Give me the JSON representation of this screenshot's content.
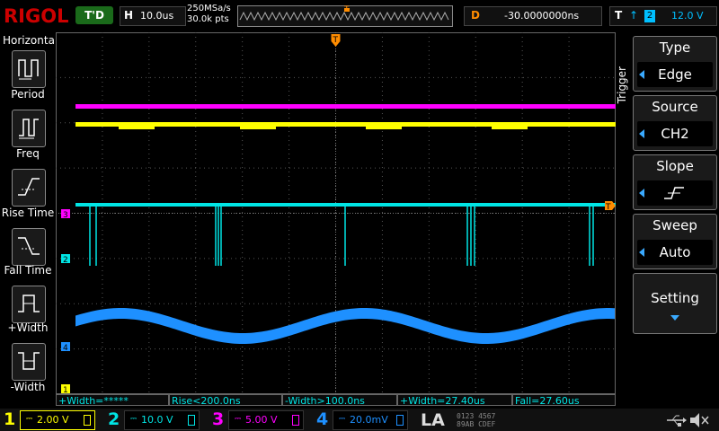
{
  "brand": {
    "logo": "RIGOL"
  },
  "topbar": {
    "run_state": "T'D",
    "horizontal": {
      "key": "H",
      "value": "10.0us"
    },
    "sample_rate": "250MSa/s",
    "mem_depth": "30.0k pts",
    "trigger_marker": "T",
    "delay": {
      "key": "D",
      "value": "-30.0000000ns"
    },
    "trigger": {
      "key": "T",
      "edge_symbol": "↑",
      "channel": "2",
      "level": "12.0 V"
    }
  },
  "left_menu": {
    "title": "Horizontal",
    "items": [
      {
        "label": "Period"
      },
      {
        "label": "Freq"
      },
      {
        "label": "Rise Time"
      },
      {
        "label": "Fall Time"
      },
      {
        "label": "+Width"
      },
      {
        "label": "-Width"
      }
    ]
  },
  "right_menu": {
    "section": "Trigger",
    "buttons": [
      {
        "header": "Type",
        "value": "Edge"
      },
      {
        "header": "Source",
        "value": "CH2"
      },
      {
        "header": "Slope",
        "value": ""
      },
      {
        "header": "Sweep",
        "value": "Auto"
      },
      {
        "header": "Setting",
        "value": ""
      }
    ]
  },
  "markers": {
    "ch3": "3",
    "ch2": "2",
    "ch4": "4",
    "ch1": "1",
    "trigger_level": "T",
    "trigger_pos": "T"
  },
  "measurements": [
    {
      "label": "+Width=*****"
    },
    {
      "label": "Rise<200.0ns"
    },
    {
      "label": "-Width>100.0ns"
    },
    {
      "label": "+Width=27.40us"
    },
    {
      "label": "Fall=27.60us"
    }
  ],
  "channels": [
    {
      "num": "1",
      "coupling": "⎓",
      "scale": "2.00 V",
      "color": "#ffff00"
    },
    {
      "num": "2",
      "coupling": "⎓",
      "scale": "10.0 V",
      "color": "#00e5e5"
    },
    {
      "num": "3",
      "coupling": "⎓",
      "scale": "5.00 V",
      "color": "#ff00ff"
    },
    {
      "num": "4",
      "coupling": "⎓",
      "scale": "20.0mV",
      "color": "#1e90ff"
    }
  ],
  "la": {
    "label": "LA",
    "bits_top": "0123 4567",
    "bits_bottom": "89AB CDEF"
  },
  "colors": {
    "ch1": "#ffff00",
    "ch2": "#00e5e5",
    "ch3": "#ff00ff",
    "ch4": "#1e90ff",
    "trigger": "#ff8c00"
  },
  "icons": [
    "usb-icon",
    "speaker-mute-icon"
  ]
}
